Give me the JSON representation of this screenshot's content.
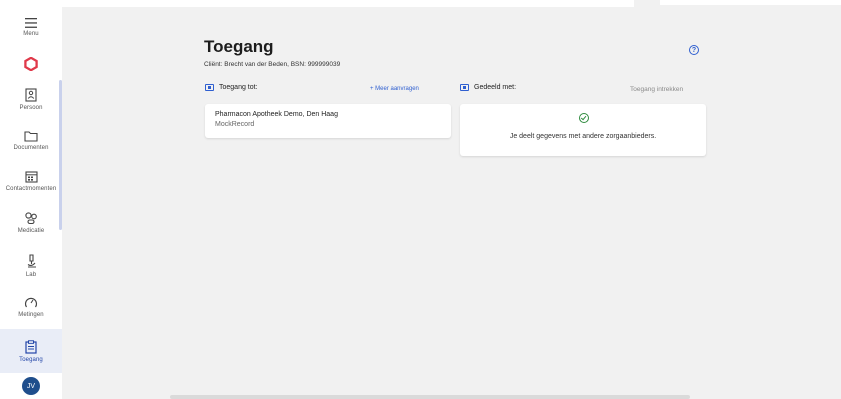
{
  "sidebar": {
    "items": [
      {
        "label": "Menu",
        "icon": "hamburger-icon"
      },
      {
        "label": "",
        "icon": "app-logo-icon"
      },
      {
        "label": "Persoon",
        "icon": "person-card-icon"
      },
      {
        "label": "Documenten",
        "icon": "folder-icon"
      },
      {
        "label": "Contactmomenten",
        "icon": "calendar-icon"
      },
      {
        "label": "Medicatie",
        "icon": "medication-icon"
      },
      {
        "label": "Lab",
        "icon": "microscope-icon"
      },
      {
        "label": "Metingen",
        "icon": "gauge-icon"
      },
      {
        "label": "Toegang",
        "icon": "access-document-icon"
      }
    ],
    "avatar_initials": "JV",
    "active_color": "#2346a8"
  },
  "page": {
    "title": "Toegang",
    "client": "Cliënt: Brecht van der Beden, BSN: 999999039",
    "help_symbol": "?"
  },
  "access_to": {
    "heading": "Toegang tot:",
    "request_more": "+ Meer aanvragen",
    "cards": [
      {
        "name": "Pharmacon Apotheek Demo, Den Haag",
        "subtitle": "MockRecord"
      }
    ]
  },
  "shared_with": {
    "heading": "Gedeeld met:",
    "revoke": "Toegang intrekken",
    "empty_message": "Je deelt gegevens met andere zorgaanbieders."
  },
  "colors": {
    "accent": "#2f5fd0",
    "success": "#2e8b3e",
    "logo": "#e0394a"
  }
}
